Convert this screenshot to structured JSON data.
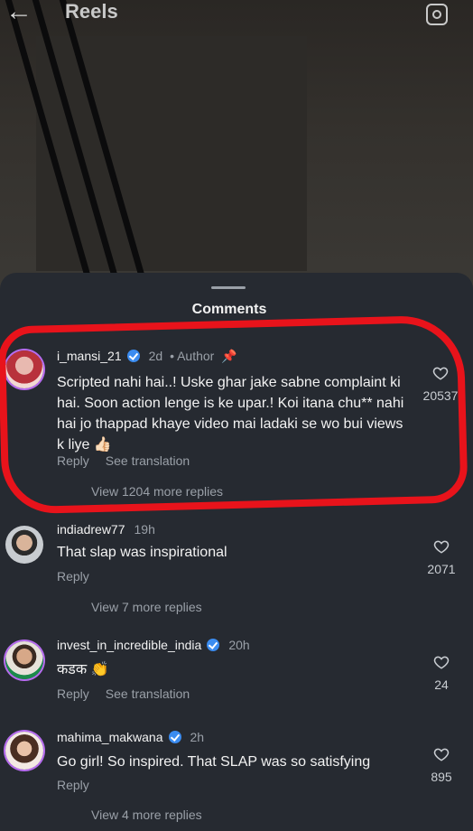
{
  "topbar": {
    "title": "Reels",
    "back_icon": "back-arrow-icon",
    "camera_icon": "camera-icon"
  },
  "sheet": {
    "title": "Comments"
  },
  "comments": [
    {
      "username": "i_mansi_21",
      "verified": true,
      "time": "2d",
      "tag": "• Author",
      "text": "Scripted nahi hai..! Uske ghar jake sabne complaint ki hai. Soon action lenge is ke upar.! Koi itana chu** nahi hai jo thappad khaye video mai ladaki se wo bui views k liye 👍🏻",
      "reply_label": "Reply",
      "translate_label": "See translation",
      "more_replies": "View 1204 more replies",
      "likes": "20537"
    },
    {
      "username": "indiadrew77",
      "verified": false,
      "time": "19h",
      "text": "That slap was inspirational",
      "reply_label": "Reply",
      "more_replies": "View 7 more replies",
      "likes": "2071"
    },
    {
      "username": "invest_in_incredible_india",
      "verified": true,
      "time": "20h",
      "text": "कडक 👏",
      "reply_label": "Reply",
      "translate_label": "See translation",
      "likes": "24"
    },
    {
      "username": "mahima_makwana",
      "verified": true,
      "time": "2h",
      "text": "Go girl! So inspired. That SLAP was so satisfying",
      "reply_label": "Reply",
      "more_replies": "View 4 more replies",
      "likes": "895"
    }
  ],
  "colors": {
    "sheet_bg": "#262a31",
    "highlight": "#e8131b",
    "verified": "#3b8cf0",
    "muted": "#9aa0a8"
  }
}
